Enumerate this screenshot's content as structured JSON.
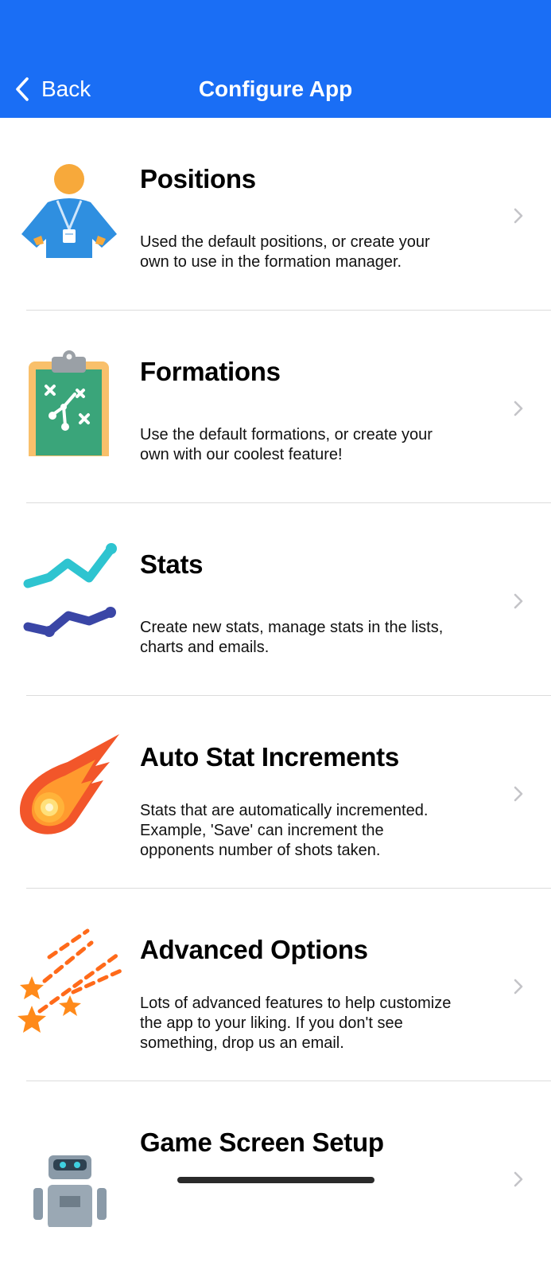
{
  "nav": {
    "back_label": "Back",
    "title": "Configure App"
  },
  "colors": {
    "nav_background": "#1a6ef5",
    "chevron": "#c4c4c8",
    "separator": "#dcdcdc"
  },
  "items": [
    {
      "title": "Positions",
      "description_lines": [
        "Used the default positions, or create your",
        "own to use in the formation manager."
      ],
      "icon": "coach-icon"
    },
    {
      "title": "Formations",
      "description_lines": [
        "Use the default formations, or create your",
        "own with our coolest feature!"
      ],
      "icon": "clipboard-tactics-icon"
    },
    {
      "title": "Stats",
      "description_lines": [
        "Create new stats, manage stats in the lists,",
        "charts and emails."
      ],
      "icon": "line-chart-icon"
    },
    {
      "title": "Auto Stat Increments",
      "description_lines": [
        "Stats that are automatically incremented.",
        "Example, 'Save' can increment the",
        "opponents number of shots taken."
      ],
      "icon": "comet-icon"
    },
    {
      "title": "Advanced Options",
      "description_lines": [
        "Lots of advanced features to help customize",
        "the app to your liking.  If you don't see",
        "something, drop us an email."
      ],
      "icon": "shooting-stars-icon"
    },
    {
      "title": "Game Screen Setup",
      "description_lines": [],
      "icon": "robot-icon"
    }
  ]
}
